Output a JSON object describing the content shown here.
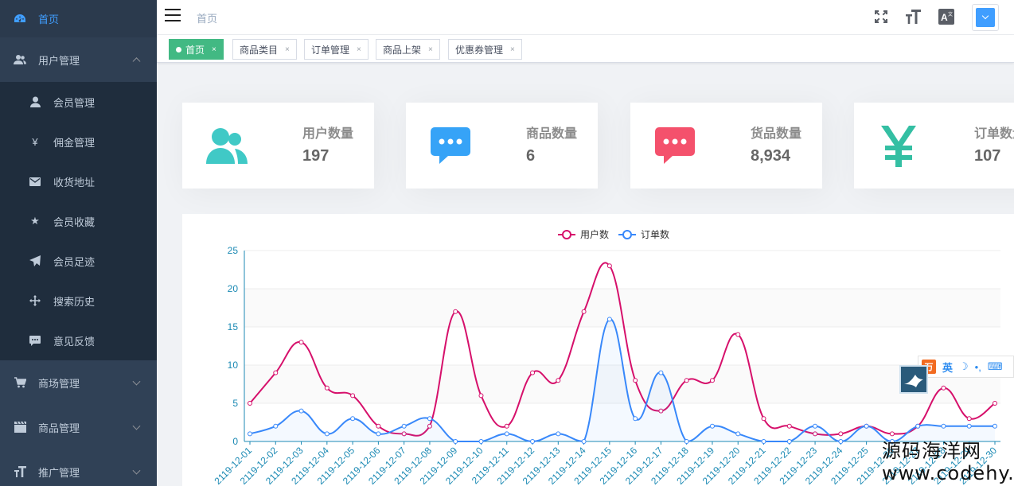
{
  "sidebar": {
    "home": {
      "label": "首页",
      "icon": "dashboard-icon"
    },
    "user_management": {
      "label": "用户管理",
      "icon": "users-icon",
      "expanded": true
    },
    "sub_items": [
      {
        "label": "会员管理",
        "icon": "person-icon"
      },
      {
        "label": "佣金管理",
        "icon": "yen-icon"
      },
      {
        "label": "收货地址",
        "icon": "envelope-icon"
      },
      {
        "label": "会员收藏",
        "icon": "star-icon"
      },
      {
        "label": "会员足迹",
        "icon": "paper-plane-icon"
      },
      {
        "label": "搜索历史",
        "icon": "move-icon"
      },
      {
        "label": "意见反馈",
        "icon": "comment-icon"
      }
    ],
    "mall_management": {
      "label": "商场管理",
      "icon": "cart-icon"
    },
    "goods_management": {
      "label": "商品管理",
      "icon": "clapper-icon"
    },
    "promotion_management": {
      "label": "推广管理",
      "icon": "text-size-icon"
    }
  },
  "topbar": {
    "breadcrumb": "首页",
    "tools": [
      "fullscreen-icon",
      "text-size-icon",
      "translate-icon"
    ],
    "translate_glyph": "A"
  },
  "tags": [
    {
      "label": "首页",
      "active": true
    },
    {
      "label": "商品类目",
      "active": false
    },
    {
      "label": "订单管理",
      "active": false
    },
    {
      "label": "商品上架",
      "active": false
    },
    {
      "label": "优惠券管理",
      "active": false
    }
  ],
  "tag_close": "×",
  "cards": [
    {
      "label": "用户数量",
      "value": "197",
      "icon": "users-icon",
      "color": "#40c9c6"
    },
    {
      "label": "商品数量",
      "value": "6",
      "icon": "message-icon",
      "color": "#36a3f7"
    },
    {
      "label": "货品数量",
      "value": "8,934",
      "icon": "message-icon",
      "color": "#f4516c"
    },
    {
      "label": "订单数量",
      "value": "107",
      "icon": "yen-icon",
      "color": "#34bfa3"
    }
  ],
  "chart_data": {
    "type": "line",
    "x": [
      "2119-12-01",
      "2119-12-02",
      "2119-12-03",
      "2119-12-04",
      "2119-12-05",
      "2119-12-06",
      "2119-12-07",
      "2119-12-08",
      "2119-12-09",
      "2119-12-10",
      "2119-12-11",
      "2119-12-12",
      "2119-12-13",
      "2119-12-14",
      "2119-12-15",
      "2119-12-16",
      "2119-12-17",
      "2119-12-18",
      "2119-12-19",
      "2119-12-20",
      "2119-12-21",
      "2119-12-22",
      "2119-12-23",
      "2119-12-24",
      "2119-12-25",
      "2119-12-26",
      "2119-12-27",
      "2119-12-28",
      "2119-12-29",
      "2119-12-30"
    ],
    "series": [
      {
        "name": "用户数",
        "color": "#d6106b",
        "values": [
          5,
          9,
          13,
          7,
          6,
          2,
          1,
          2,
          17,
          6,
          2,
          9,
          8,
          17,
          23,
          8,
          4,
          8,
          8,
          14,
          3,
          2,
          1,
          1,
          2,
          1,
          2,
          7,
          3,
          5
        ]
      },
      {
        "name": "订单数",
        "color": "#3888fa",
        "values": [
          1,
          2,
          4,
          1,
          3,
          1,
          2,
          3,
          0,
          0,
          1,
          0,
          1,
          0,
          16,
          3,
          9,
          0,
          2,
          1,
          0,
          0,
          2,
          0,
          2,
          0,
          2,
          2,
          2,
          2
        ]
      }
    ],
    "ylim": [
      0,
      25
    ],
    "yticks": [
      "0",
      "5",
      "10",
      "15",
      "20",
      "25"
    ],
    "grid": true,
    "legend": "top-center"
  },
  "ime": {
    "logo": "万",
    "mode": "英",
    "moon": "☽",
    "punct": "•,",
    "keyboard": "⌨"
  },
  "watermark": {
    "line1": "源码海洋网",
    "line2": "www.codehy.com"
  }
}
